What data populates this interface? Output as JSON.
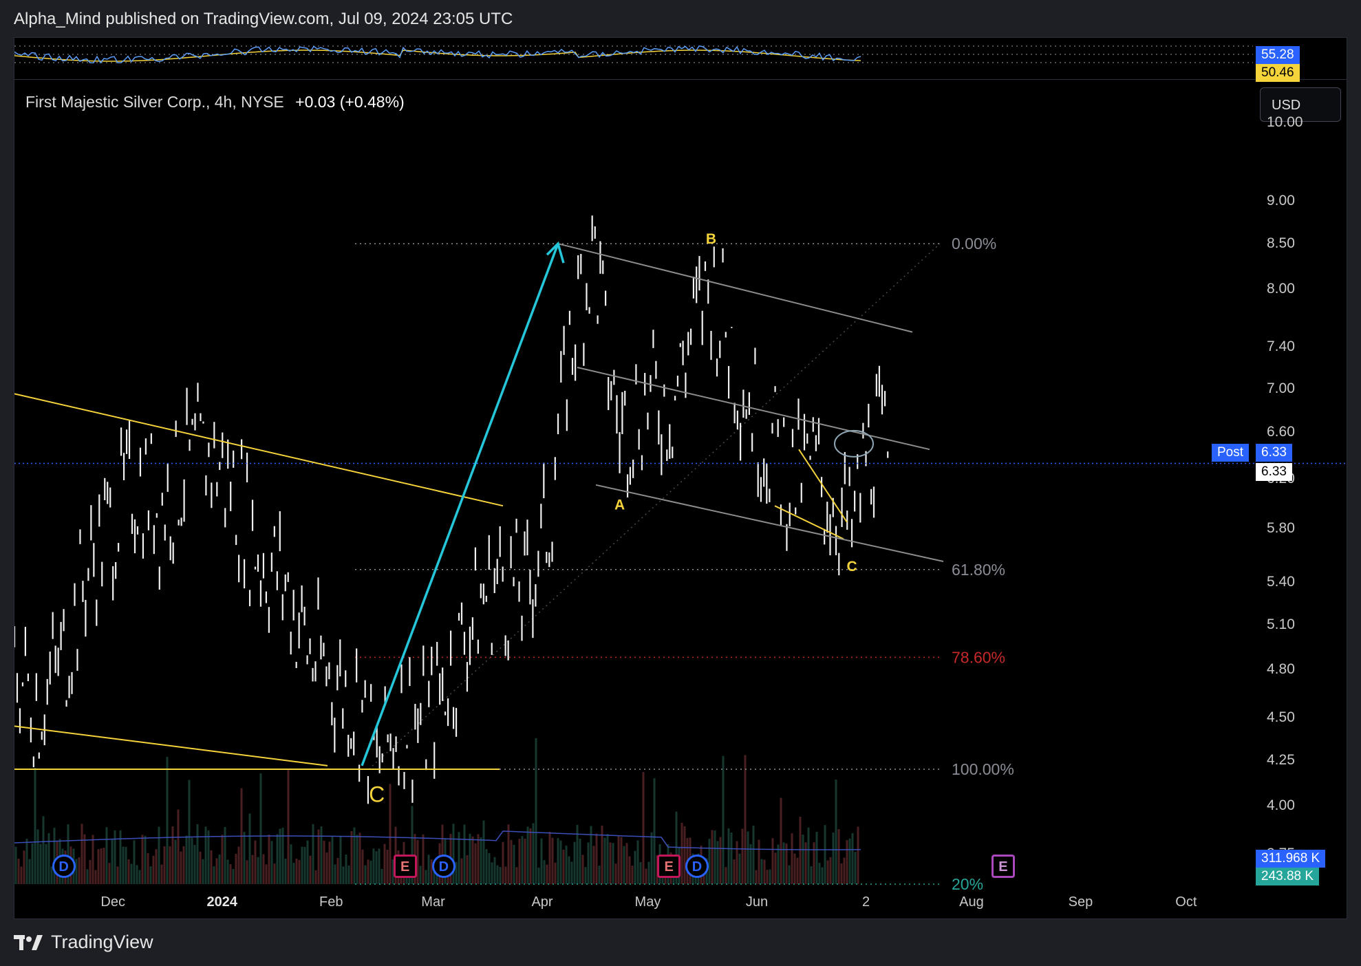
{
  "header": {
    "publisher_line": "Alpha_Mind published on TradingView.com, Jul 09, 2024 23:05 UTC"
  },
  "symbol": {
    "name": "First Majestic Silver Corp., 4h, NYSE",
    "change": "+0.03 (+0.48%)",
    "currency": "USD"
  },
  "rsi": {
    "rsi_value": "55.28",
    "ma_value": "50.46",
    "rsi_color": "#5b9cf6",
    "ma_color": "#f5d33b"
  },
  "price_axis": {
    "labels": [
      "10.00",
      "9.00",
      "8.50",
      "8.00",
      "7.40",
      "7.00",
      "6.60",
      "6.20",
      "5.80",
      "5.40",
      "5.10",
      "4.80",
      "4.50",
      "4.25",
      "4.00",
      "3.75"
    ]
  },
  "current_price": {
    "post_label": "Post",
    "post_value": "6.33",
    "last_value": "6.33"
  },
  "volume": {
    "value1": "311.968 K",
    "value2": "243.88 K"
  },
  "fib_levels": [
    {
      "label": "0.00%",
      "price": 8.5,
      "color": "#8a8d96"
    },
    {
      "label": "61.80%",
      "price": 5.49,
      "color": "#8a8d96"
    },
    {
      "label": "78.60%",
      "price": 4.88,
      "color": "#c62828"
    },
    {
      "label": "100.00%",
      "price": 4.2,
      "color": "#8a8d96"
    },
    {
      "label": "20%",
      "price": 3.6,
      "color": "#26a69a"
    }
  ],
  "wave_labels": [
    {
      "text": "C",
      "date": "2024-02-14",
      "price": 4.02,
      "color": "#f5d33b",
      "size": "big"
    },
    {
      "text": "A",
      "date": "2024-04-23",
      "price": 5.95,
      "color": "#f5d33b",
      "size": "small"
    },
    {
      "text": "B",
      "date": "2024-05-19",
      "price": 8.5,
      "color": "#f5d33b",
      "size": "small"
    },
    {
      "text": "C",
      "date": "2024-06-28",
      "price": 5.48,
      "color": "#f5d33b",
      "size": "small"
    }
  ],
  "time_axis": {
    "labels": [
      {
        "text": "Dec",
        "date": "2023-12-01",
        "bold": false
      },
      {
        "text": "2024",
        "date": "2024-01-01",
        "bold": true
      },
      {
        "text": "Feb",
        "date": "2024-02-01",
        "bold": false
      },
      {
        "text": "Mar",
        "date": "2024-03-01",
        "bold": false
      },
      {
        "text": "Apr",
        "date": "2024-04-01",
        "bold": false
      },
      {
        "text": "May",
        "date": "2024-05-01",
        "bold": false
      },
      {
        "text": "Jun",
        "date": "2024-06-01",
        "bold": false
      },
      {
        "text": "2",
        "date": "2024-07-02",
        "bold": false
      },
      {
        "text": "Aug",
        "date": "2024-08-01",
        "bold": false
      },
      {
        "text": "Sep",
        "date": "2024-09-01",
        "bold": false
      },
      {
        "text": "Oct",
        "date": "2024-10-01",
        "bold": false
      }
    ]
  },
  "event_markers": [
    {
      "type": "D",
      "date": "2023-11-17"
    },
    {
      "type": "E",
      "date": "2024-02-22"
    },
    {
      "type": "D",
      "date": "2024-03-04"
    },
    {
      "type": "E",
      "date": "2024-05-07"
    },
    {
      "type": "D",
      "date": "2024-05-15"
    },
    {
      "type": "E2",
      "date": "2024-08-10"
    }
  ],
  "footer": {
    "brand": "TradingView"
  },
  "chart_data": {
    "type": "line",
    "title": "First Majestic Silver Corp., 4h, NYSE",
    "y_scale": "log",
    "ylim": [
      3.6,
      10.6
    ],
    "xlim": [
      "2023-11-03",
      "2024-10-20"
    ],
    "series": [
      {
        "x": [
          "2023-11-03",
          "2023-11-10",
          "2023-11-17",
          "2023-11-24",
          "2023-12-01",
          "2023-12-08",
          "2023-12-15",
          "2023-12-22",
          "2023-12-29",
          "2024-01-05",
          "2024-01-12",
          "2024-01-19",
          "2024-01-26",
          "2024-02-02",
          "2024-02-09",
          "2024-02-14",
          "2024-02-21",
          "2024-02-28",
          "2024-03-06",
          "2024-03-13",
          "2024-03-20",
          "2024-03-27",
          "2024-04-03",
          "2024-04-08",
          "2024-04-12",
          "2024-04-16",
          "2024-04-19",
          "2024-04-23",
          "2024-04-26",
          "2024-05-01",
          "2024-05-08",
          "2024-05-14",
          "2024-05-19",
          "2024-05-24",
          "2024-05-29",
          "2024-06-03",
          "2024-06-07",
          "2024-06-12",
          "2024-06-17",
          "2024-06-21",
          "2024-06-26",
          "2024-06-28",
          "2024-07-02",
          "2024-07-05",
          "2024-07-09"
        ],
        "values": [
          4.8,
          4.6,
          4.9,
          5.5,
          5.9,
          6.2,
          6.0,
          6.3,
          6.4,
          6.1,
          5.6,
          5.4,
          4.9,
          4.75,
          4.6,
          4.2,
          4.55,
          4.45,
          4.8,
          5.2,
          5.45,
          5.3,
          5.9,
          7.2,
          8.0,
          8.45,
          7.4,
          6.6,
          6.8,
          6.9,
          6.9,
          7.6,
          8.1,
          7.5,
          7.0,
          6.6,
          6.4,
          6.2,
          6.3,
          6.1,
          5.9,
          5.72,
          6.4,
          6.55,
          6.33
        ]
      }
    ],
    "grid": false,
    "legend": "none"
  }
}
